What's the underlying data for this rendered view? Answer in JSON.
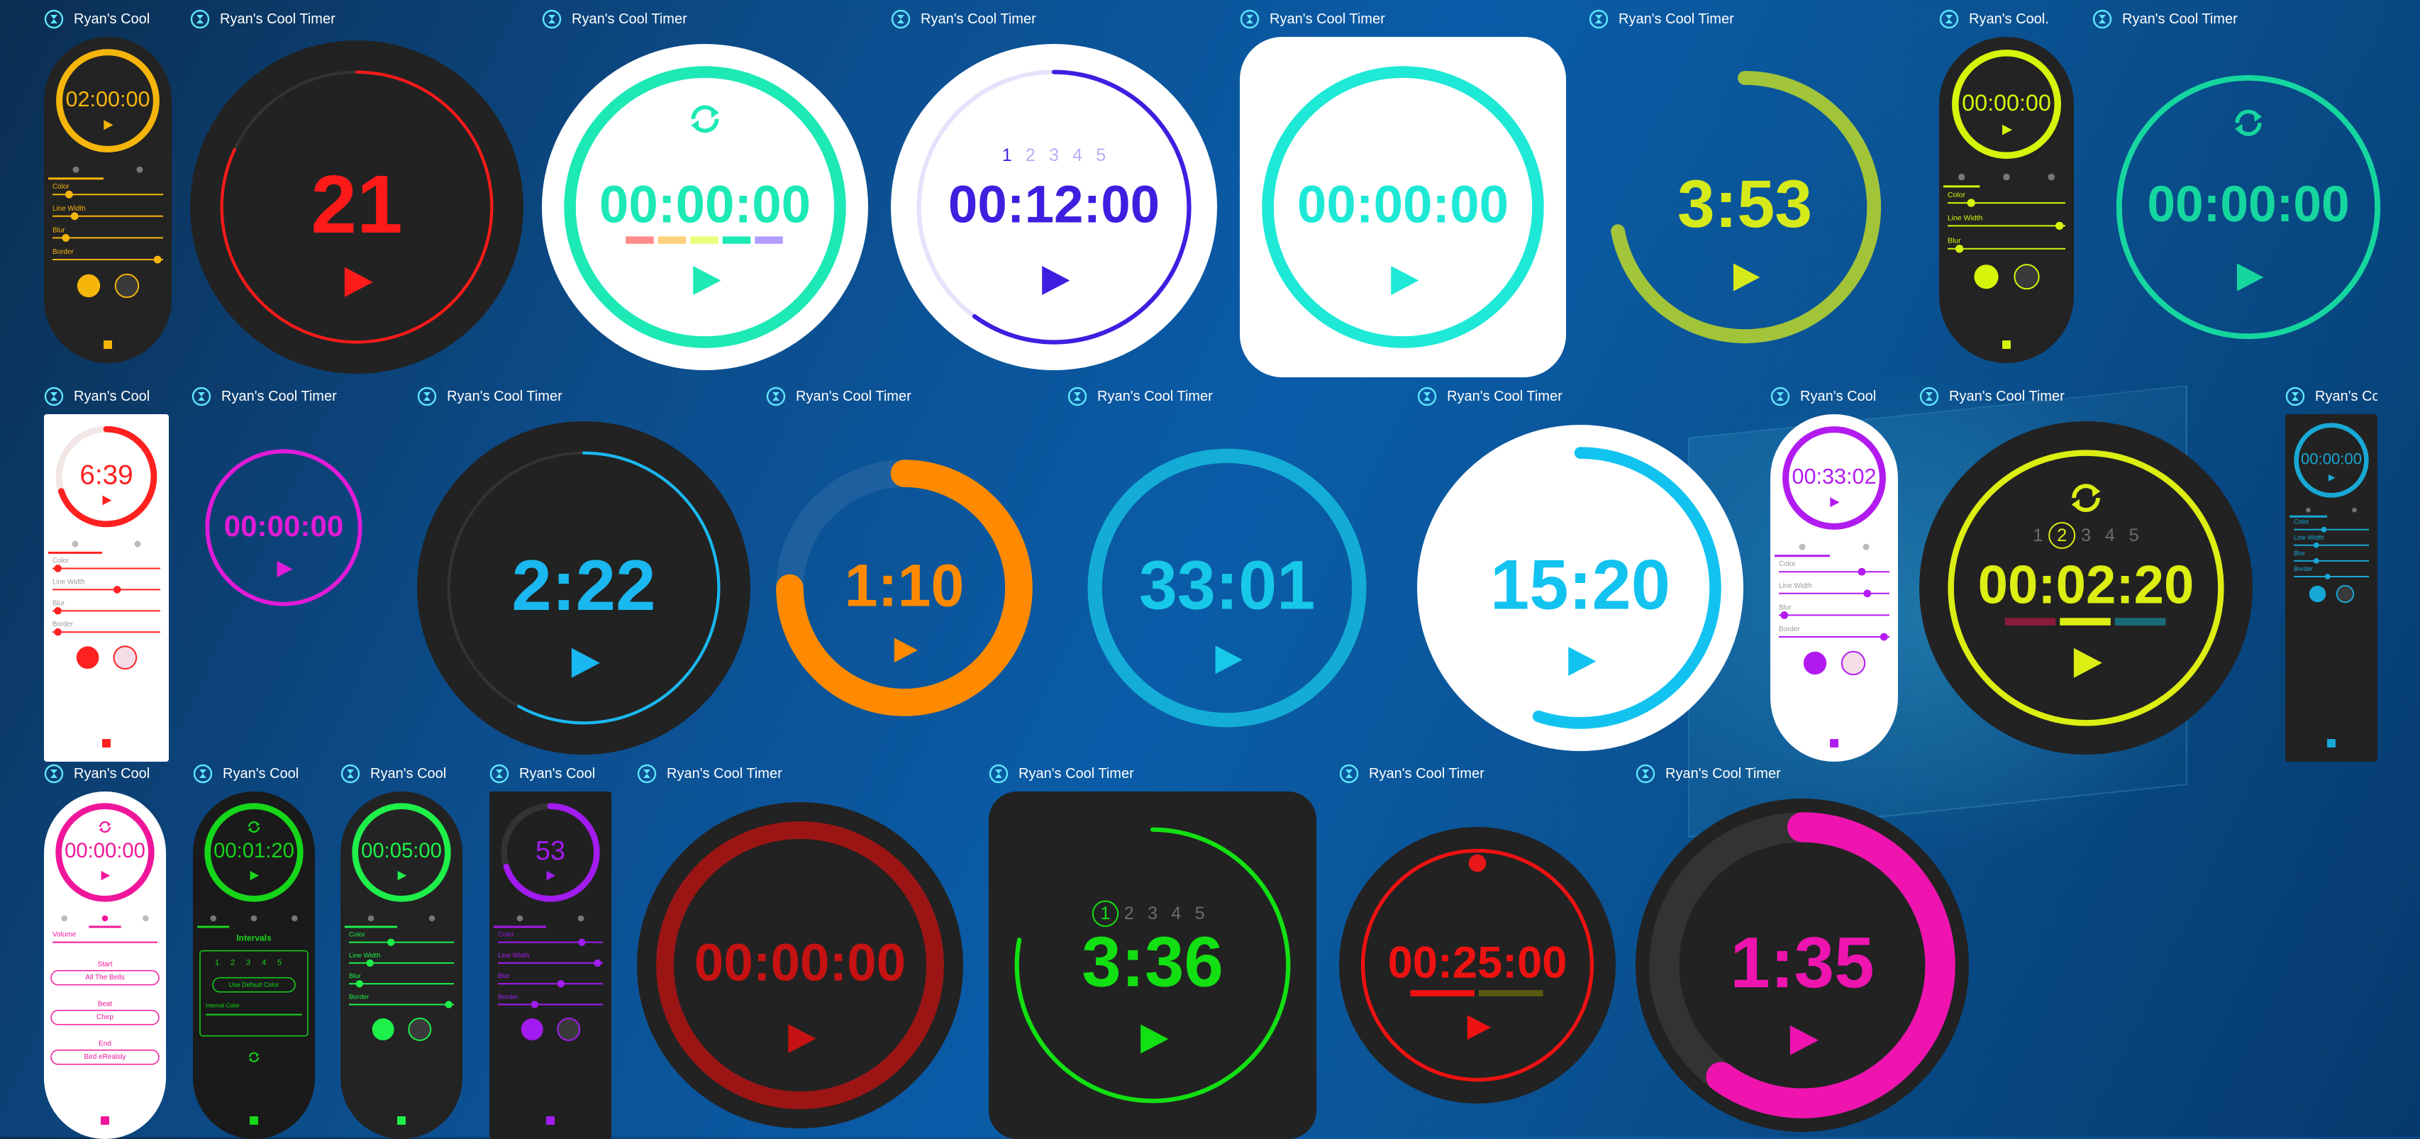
{
  "app": {
    "title": "Ryan's Cool Timer"
  },
  "timers": [
    {
      "id": "t1",
      "title": "Ryan's Cool",
      "time": "02:00:00",
      "accent": "#f5b50b",
      "bg": "#232323",
      "style": "panel",
      "tabs": [
        "palette-icon",
        "volume-icon"
      ],
      "sliders": [
        "Color",
        "Line Width",
        "Blur",
        "Border"
      ],
      "slider_values": [
        0.15,
        0.2,
        0.12,
        0.95
      ],
      "save": "save-icon"
    },
    {
      "id": "t2",
      "title": "Ryan's Cool Timer",
      "time": "21",
      "accent": "#ff1a1a",
      "bg": "#222222",
      "style": "dark-circle",
      "progress": 0.82
    },
    {
      "id": "t3",
      "title": "Ryan's Cool Timer",
      "time": "00:00:00",
      "accent": "#1de9b6",
      "bg": "#ffffff",
      "style": "white-circle",
      "progress": 1.0,
      "segment_colors": [
        "#ff8a8a",
        "#ffd27a",
        "#e9ff7a",
        "#1de9b6",
        "#b39cff"
      ]
    },
    {
      "id": "t4",
      "title": "Ryan's Cool Timer",
      "time": "00:12:00",
      "accent": "#3d1fe0",
      "bg": "#ffffff",
      "style": "white-circle-steps",
      "progress": 0.6,
      "steps": [
        "1",
        "2",
        "3",
        "4",
        "5"
      ]
    },
    {
      "id": "t5",
      "title": "Ryan's Cool Timer",
      "time": "00:00:00",
      "accent": "#1de9d6",
      "bg": "#ffffff",
      "style": "white-square",
      "progress": 1.0
    },
    {
      "id": "t6",
      "title": "Ryan's Cool Timer",
      "time": "3:53",
      "accent": "#d6ea1a",
      "bg": "transparent",
      "style": "glow",
      "progress": 0.72
    },
    {
      "id": "t7",
      "title": "Ryan's Cool.",
      "time": "00:00:00",
      "accent": "#d6f50b",
      "bg": "#232323",
      "style": "panel",
      "tabs": [
        "palette-icon",
        "volume-icon",
        "hourglass-icon"
      ],
      "sliders": [
        "Color",
        "Line Width",
        "Blur"
      ],
      "slider_values": [
        0.2,
        0.95,
        0.1
      ],
      "save": "save-icon"
    },
    {
      "id": "t8",
      "title": "Ryan's Cool Timer",
      "time": "00:00:00",
      "accent": "#16d6a0",
      "bg": "transparent",
      "style": "glow-ring",
      "progress": 1.0
    },
    {
      "id": "t9",
      "title": "Ryan's Cool",
      "time": "6:39",
      "accent": "#ff2020",
      "bg": "#ffffff",
      "style": "panel",
      "tabs": [
        "palette-icon",
        "volume-icon"
      ],
      "sliders": [
        "Color",
        "Line Width",
        "Blur",
        "Border"
      ],
      "slider_values": [
        0.05,
        0.6,
        0.05,
        0.05
      ],
      "save": "save-icon",
      "progress": 0.7
    },
    {
      "id": "t10",
      "title": "Ryan's Cool Timer",
      "time": "00:00:00",
      "accent": "#e11bd8",
      "bg": "transparent",
      "style": "ring-only",
      "progress": 1.0
    },
    {
      "id": "t11",
      "title": "Ryan's Cool Timer",
      "time": "2:22",
      "accent": "#1ab8f0",
      "bg": "#222222",
      "style": "dark-circle",
      "progress": 0.58
    },
    {
      "id": "t12",
      "title": "Ryan's Cool Timer",
      "time": "1:10",
      "accent": "#ff8a00",
      "bg": "transparent",
      "style": "thick-ring",
      "progress": 0.75
    },
    {
      "id": "t13",
      "title": "Ryan's Cool Timer",
      "time": "33:01",
      "accent": "#18c8e8",
      "bg": "transparent",
      "style": "glow",
      "progress": 1.0
    },
    {
      "id": "t14",
      "title": "Ryan's Cool Timer",
      "time": "15:20",
      "accent": "#12c3f0",
      "bg": "#ffffff",
      "style": "white-circle",
      "progress": 0.55
    },
    {
      "id": "t15",
      "title": "Ryan's Cool",
      "time": "00:33:02",
      "accent": "#b21bf0",
      "bg": "#ffffff",
      "style": "panel",
      "tabs": [
        "palette-icon",
        "volume-icon"
      ],
      "sliders": [
        "Color",
        "Line Width",
        "Blur",
        "Border"
      ],
      "slider_values": [
        0.75,
        0.8,
        0.05,
        0.95
      ],
      "save": "save-icon"
    },
    {
      "id": "t16",
      "title": "Ryan's Cool Timer",
      "time": "00:02:20",
      "accent": "#dcee12",
      "bg": "#222222",
      "style": "dark-circle-steps",
      "progress": 1.0,
      "steps": [
        "1",
        "2",
        "3",
        "4",
        "5"
      ],
      "active_step": 1,
      "segment_colors": [
        "#8a1a3a",
        "#dcee12",
        "#1a6b7a"
      ]
    },
    {
      "id": "t17",
      "title": "Ryan's Cool",
      "time": "00:00:00",
      "accent": "#18a8d6",
      "bg": "#222222",
      "style": "panel",
      "tabs": [
        "palette-icon",
        "volume-icon"
      ],
      "sliders": [
        "Color",
        "Line Width",
        "Blur",
        "Border"
      ],
      "slider_values": [
        0.4,
        0.3,
        0.3,
        0.45
      ],
      "save": "save-icon"
    },
    {
      "id": "t18",
      "title": "Ryan's Cool",
      "time": "00:00:00",
      "accent": "#f0169a",
      "bg": "#ffffff",
      "style": "panel-sound",
      "tabs": [
        "palette-icon",
        "volume-icon",
        "hourglass-icon"
      ],
      "volume_label": "Volume",
      "selects": [
        {
          "label": "Start",
          "value": "All The Bells"
        },
        {
          "label": "Beat",
          "value": "Chirp"
        },
        {
          "label": "End",
          "value": "Bird eRealsly"
        }
      ],
      "save": "save-icon"
    },
    {
      "id": "t19",
      "title": "Ryan's Cool",
      "time": "00:01:20",
      "accent": "#16d61a",
      "bg": "#1a1a1a",
      "style": "panel-intervals",
      "tabs": [
        "palette-icon",
        "volume-icon",
        "hourglass-icon"
      ],
      "intervals_title": "Intervals",
      "steps": [
        "1",
        "2",
        "3",
        "4",
        "5"
      ],
      "default_button": "Use Default Color",
      "interval_color_label": "Interval Color",
      "save": "save-icon"
    },
    {
      "id": "t20",
      "title": "Ryan's Cool",
      "time": "00:05:00",
      "accent": "#1ef04a",
      "bg": "#232323",
      "style": "panel",
      "tabs": [
        "palette-icon",
        "volume-icon"
      ],
      "sliders": [
        "Color",
        "Line Width",
        "Blur",
        "Border"
      ],
      "slider_values": [
        0.4,
        0.2,
        0.1,
        0.95
      ],
      "save": "save-icon"
    },
    {
      "id": "t21",
      "title": "Ryan's Cool",
      "time": "53",
      "accent": "#a21bf0",
      "bg": "#202020",
      "style": "panel",
      "tabs": [
        "palette-icon",
        "volume-icon"
      ],
      "sliders": [
        "Color",
        "Line Width",
        "Blur",
        "Border"
      ],
      "slider_values": [
        0.8,
        0.95,
        0.6,
        0.35
      ],
      "save": "save-icon",
      "progress": 0.7
    },
    {
      "id": "t22",
      "title": "Ryan's Cool Timer",
      "time": "00:00:00",
      "accent": "#c61212",
      "bg": "#222222",
      "style": "dark-circle-blur",
      "progress": 1.0
    },
    {
      "id": "t23",
      "title": "Ryan's Cool Timer",
      "time": "3:36",
      "accent": "#12e012",
      "bg": "#222222",
      "style": "dark-square-steps",
      "progress": 0.78,
      "steps": [
        "1",
        "2",
        "3",
        "4",
        "5"
      ],
      "active_step": 0
    },
    {
      "id": "t24",
      "title": "Ryan's Cool Timer",
      "time": "00:25:00",
      "accent": "#ee1212",
      "bg": "#222222",
      "style": "dark-circle-tomato",
      "progress": 1.0,
      "segment_colors": [
        "#ee1212",
        "#5a5a12"
      ]
    },
    {
      "id": "t25",
      "title": "Ryan's Cool Timer",
      "time": "1:35",
      "accent": "#ef14b0",
      "bg": "#222222",
      "style": "dark-circle-thick",
      "progress": 0.6
    }
  ]
}
